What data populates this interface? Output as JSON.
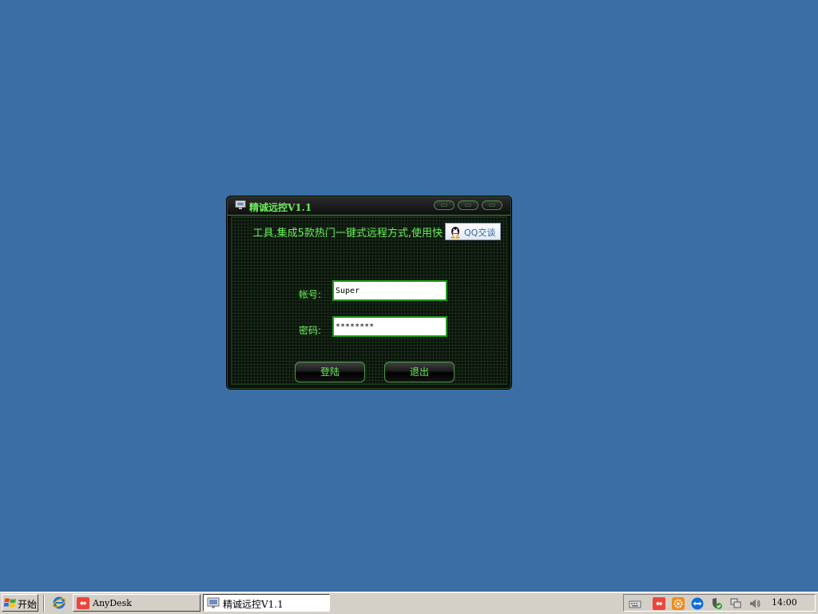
{
  "window": {
    "title": "精诚远控V1.1",
    "marquee": "工具,集成5款热门一键式远程方式,使用快",
    "qq_button": "QQ交谈",
    "account_label": "帐号:",
    "account_value": "Super",
    "password_label": "密码:",
    "password_value": "********",
    "login_button": "登陆",
    "exit_button": "退出"
  },
  "taskbar": {
    "start_label": "开始",
    "tasks": [
      {
        "label": "AnyDesk",
        "icon": "anydesk-icon",
        "active": false
      },
      {
        "label": "精诚远控V1.1",
        "icon": "app-window-icon",
        "active": true
      }
    ],
    "tray_icons": [
      "keyboard-icon",
      "anydesk-icon",
      "settings-icon",
      "teamviewer-icon",
      "shield-icon",
      "network-icon",
      "volume-icon"
    ],
    "clock": "14:00"
  },
  "colors": {
    "desktop": "#3a6ea5",
    "accent_green": "#69f25b",
    "window_bg": "#0c110c",
    "taskbar": "#d4d0c8"
  }
}
